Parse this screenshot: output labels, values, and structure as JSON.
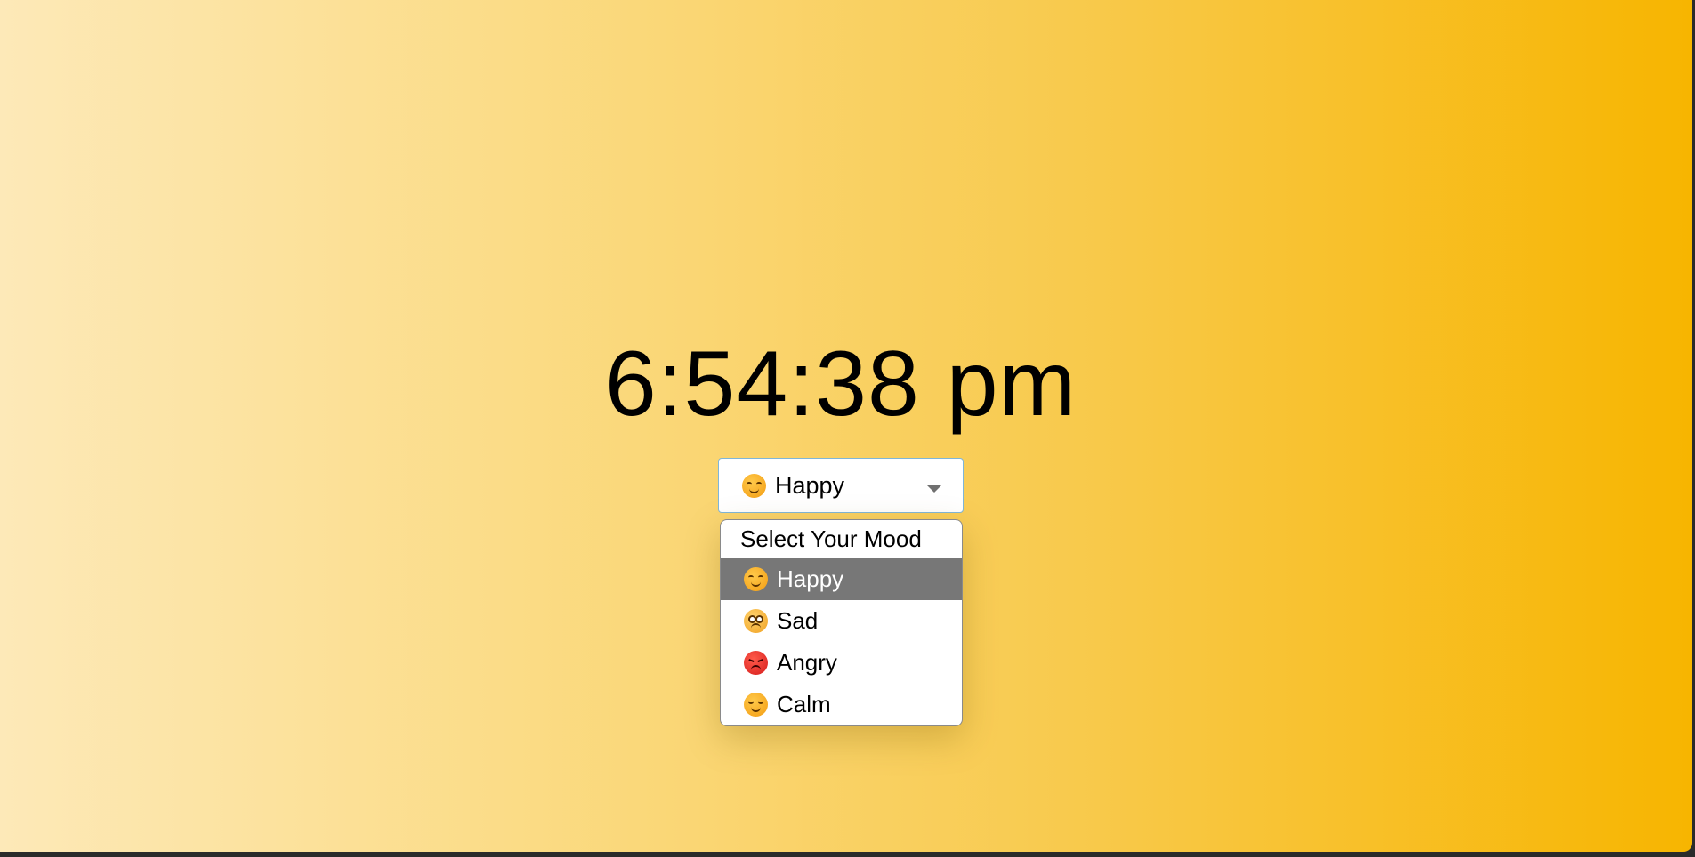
{
  "clock": {
    "time": "6:54:38 pm"
  },
  "mood_select": {
    "selected_label": "Happy",
    "selected_icon": "smiling-face-icon",
    "options": [
      {
        "label": "Select Your Mood",
        "icon": ""
      },
      {
        "label": "Happy",
        "icon": "smiling-face-icon"
      },
      {
        "label": "Sad",
        "icon": "crying-face-icon"
      },
      {
        "label": "Angry",
        "icon": "angry-face-icon"
      },
      {
        "label": "Calm",
        "icon": "relieved-face-icon"
      }
    ],
    "highlighted_index": 1
  },
  "colors": {
    "background_start": "#fde9b8",
    "background_end": "#f7b500",
    "highlight": "#777777",
    "select_border": "#7fb6d9"
  }
}
